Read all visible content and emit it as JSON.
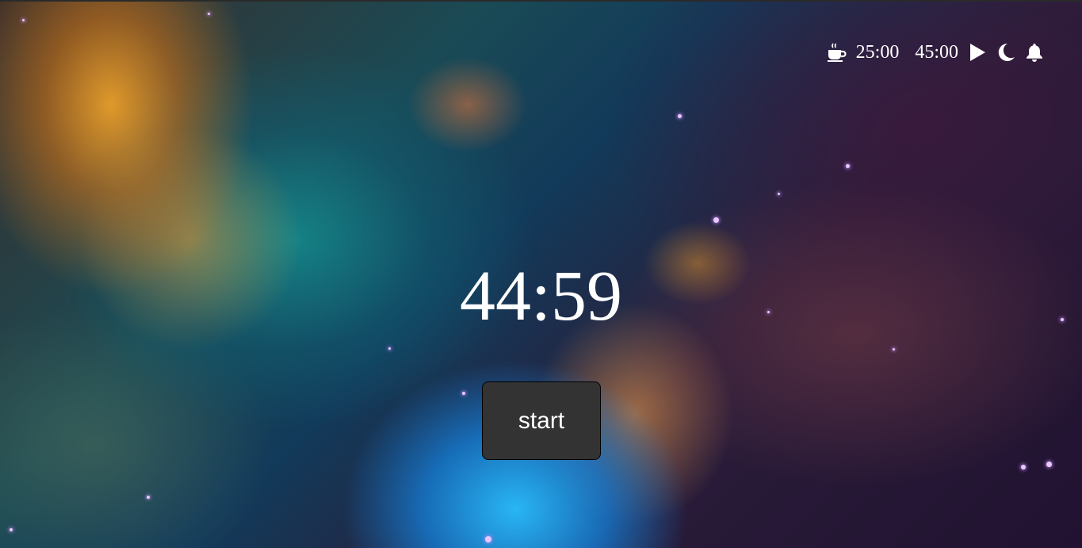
{
  "toolbar": {
    "break_icon": "coffee-icon",
    "short_duration": "25:00",
    "long_duration": "45:00",
    "play_icon": "play-icon",
    "theme_icon": "moon-icon",
    "sound_icon": "bell-icon"
  },
  "timer": {
    "display": "44:59"
  },
  "controls": {
    "start_label": "start"
  },
  "colors": {
    "text": "#ffffff",
    "button_bg": "#333333",
    "button_border": "#000000"
  }
}
